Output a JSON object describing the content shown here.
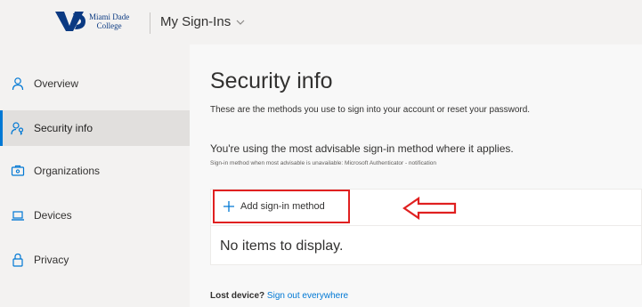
{
  "header": {
    "brand_line1": "Miami Dade",
    "brand_line2": "College",
    "app_title": "My Sign-Ins"
  },
  "sidebar": {
    "items": [
      {
        "label": "Overview",
        "icon": "person-icon",
        "active": false
      },
      {
        "label": "Security info",
        "icon": "security-info-icon",
        "active": true
      },
      {
        "label": "Organizations",
        "icon": "organizations-icon",
        "active": false
      },
      {
        "label": "Devices",
        "icon": "laptop-icon",
        "active": false
      },
      {
        "label": "Privacy",
        "icon": "lock-icon",
        "active": false
      }
    ]
  },
  "main": {
    "title": "Security info",
    "description": "These are the methods you use to sign into your account or reset your password.",
    "advisable": "You're using the most advisable sign-in method where it applies.",
    "advisable_sub": "Sign-in method when most advisable is unavailable: Microsoft Authenticator - notification",
    "add_method_label": "Add sign-in method",
    "empty_text": "No items to display.",
    "lost_device_label": "Lost device?",
    "sign_out_link": "Sign out everywhere"
  },
  "colors": {
    "accent": "#0078d4",
    "highlight": "#e02020",
    "brand": "#0b3a82"
  }
}
